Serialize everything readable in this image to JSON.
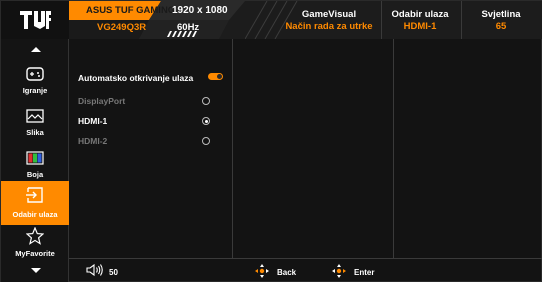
{
  "header": {
    "model_name": "ASUS TUF GAMING",
    "model_code": "VG249Q3R",
    "resolution": "1920 x 1080",
    "refresh": "60Hz",
    "columns": [
      {
        "title": "GameVisual",
        "value": "Način rada za utrke"
      },
      {
        "title": "Odabir ulaza",
        "value": "HDMI-1"
      },
      {
        "title": "Svjetlina",
        "value": "65"
      }
    ]
  },
  "sidebar": {
    "items": [
      {
        "label": "Igranje",
        "icon": "gamepad-icon"
      },
      {
        "label": "Slika",
        "icon": "image-icon"
      },
      {
        "label": "Boja",
        "icon": "color-bars-icon"
      },
      {
        "label": "Odabir ulaza",
        "icon": "input-select-icon",
        "active": true
      },
      {
        "label": "MyFavorite",
        "icon": "star-icon"
      }
    ]
  },
  "menu": {
    "auto_detect_label": "Automatsko otkrivanje ulaza",
    "auto_detect_on": true,
    "options": [
      {
        "label": "DisplayPort",
        "enabled": false,
        "selected": false
      },
      {
        "label": "HDMI-1",
        "enabled": true,
        "selected": true
      },
      {
        "label": "HDMI-2",
        "enabled": false,
        "selected": false
      }
    ]
  },
  "footer": {
    "volume": "50",
    "back_label": "Back",
    "enter_label": "Enter"
  },
  "colors": {
    "accent": "#ff8a00",
    "background": "#131313",
    "disabled_text": "#777777"
  }
}
